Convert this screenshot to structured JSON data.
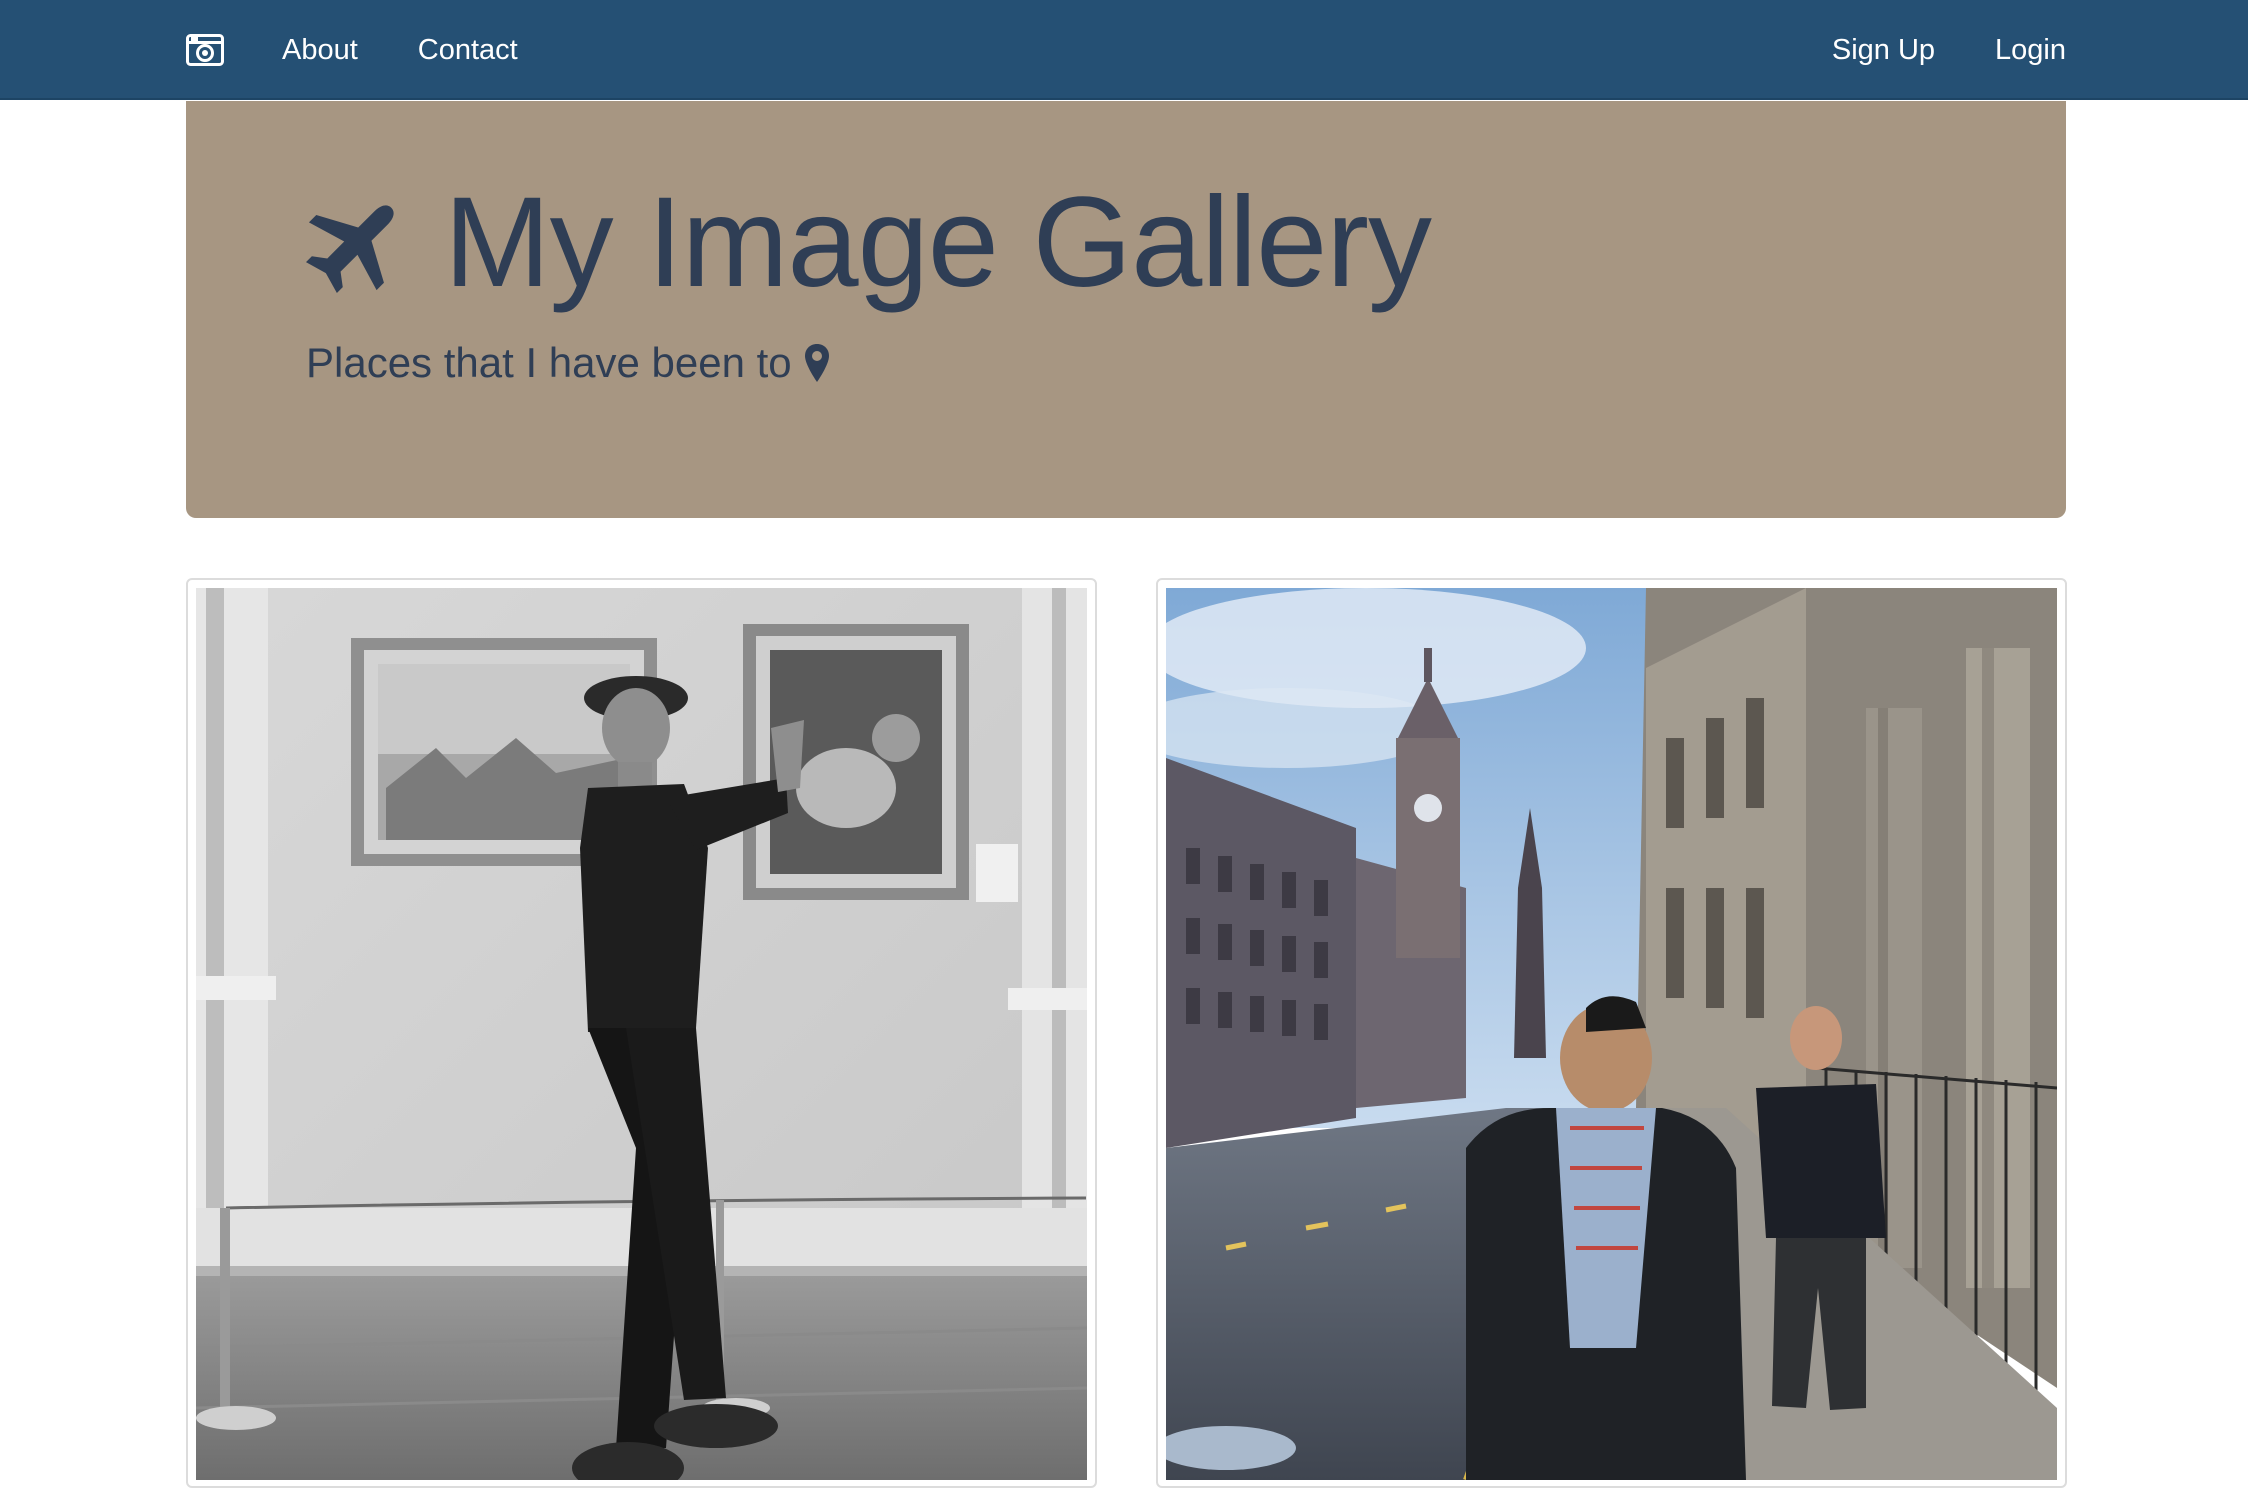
{
  "navbar": {
    "brand_icon": "camera-icon",
    "links": [
      "About",
      "Contact"
    ],
    "right_links": [
      "Sign Up",
      "Login"
    ],
    "background": "#255074"
  },
  "jumbotron": {
    "title_icon": "plane-icon",
    "title": "My Image Gallery",
    "subtitle": "Places that I have been to",
    "subtitle_icon": "map-marker-icon",
    "background": "#a79682",
    "text_color": "#2f3e55"
  },
  "gallery": {
    "photos": [
      {
        "style": "black-and-white",
        "scene": "museum"
      },
      {
        "style": "color",
        "scene": "city-street"
      }
    ]
  }
}
